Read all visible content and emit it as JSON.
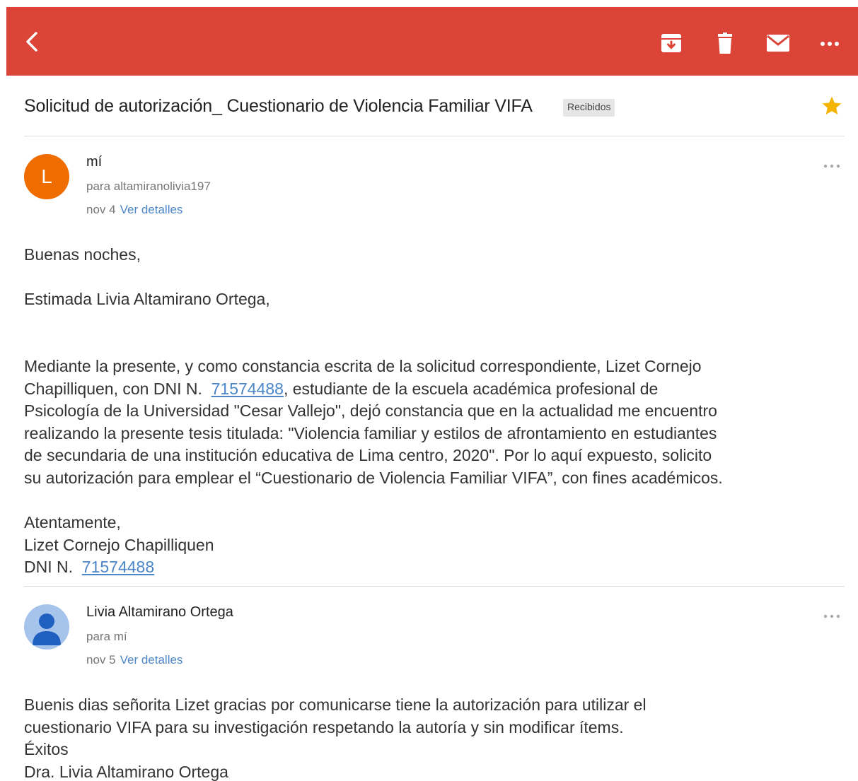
{
  "colors": {
    "accent": "#db4437",
    "link": "#4a86c8",
    "star": "#f4b400",
    "avatar_l": "#ef6c00",
    "avatar_person": "#a6c3ec"
  },
  "toolbar": {
    "icons": [
      "back-arrow-icon",
      "archive-icon",
      "trash-icon",
      "mail-icon",
      "more-icon"
    ]
  },
  "thread": {
    "subject": "Solicitud de autorización_ Cuestionario de Violencia Familiar VIFA",
    "label": "Recibidos",
    "starred": true
  },
  "messages": [
    {
      "avatar_letter": "L",
      "sender": "mí",
      "recipient": "para altamiranolivia197",
      "date": "nov 4",
      "details_label": "Ver detalles",
      "greeting": "Buenas noches,",
      "salutation": "Estimada Livia Altamirano Ortega,",
      "para_lines": [
        "Mediante la presente, y como constancia escrita de la solicitud correspondiente, Lizet Cornejo",
        "Chapilliquen, con DNI N.",
        "71574488",
        ", estudiante de la escuela académica profesional de",
        "Psicología de la Universidad \"Cesar Vallejo\", dejó constancia que en la actualidad me encuentro",
        "realizando la presente tesis titulada: \"Violencia familiar y estilos de afrontamiento en estudiantes",
        "de secundaria de una institución educativa de Lima centro, 2020\". Por lo aquí expuesto, solicito",
        "su autorización para emplear el “Cuestionario de Violencia Familiar VIFA”, con fines académicos."
      ],
      "closing": "Atentamente,",
      "signature_name": "Lizet Cornejo Chapilliquen",
      "signature_dni_label": "DNI N.",
      "signature_dni": "71574488"
    },
    {
      "sender": "Livia Altamirano Ortega",
      "recipient": "para mí",
      "date": "nov 5",
      "details_label": "Ver detalles",
      "lines": [
        "Buenis dias señorita Lizet gracias por comunicarse tiene la autorización para utilizar el",
        "cuestionario VIFA para su investigación respetando la autoría y sin modificar ítems.",
        "Éxitos",
        "Dra. Livia Altamirano Ortega"
      ]
    }
  ]
}
